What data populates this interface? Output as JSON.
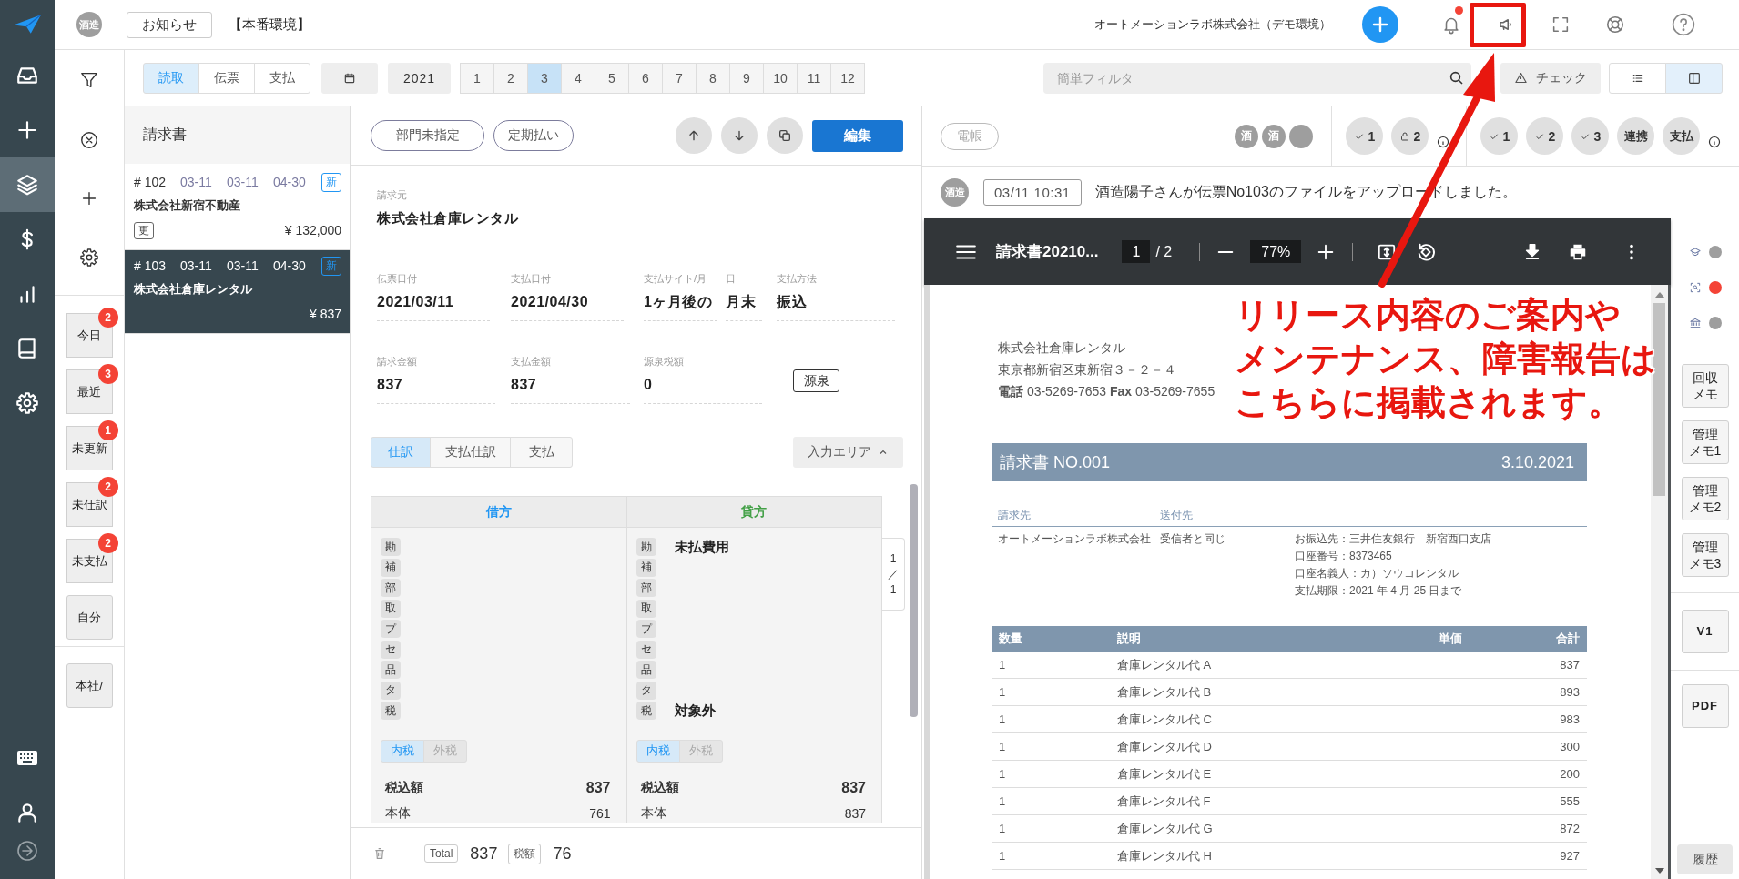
{
  "nav": {
    "items": [
      {
        "selected": false
      },
      {
        "selected": false
      },
      {
        "selected": true
      },
      {
        "selected": false
      },
      {
        "selected": false
      },
      {
        "selected": false
      },
      {
        "selected": false
      }
    ]
  },
  "top_bar": {
    "avatar": "酒造",
    "notice_button": "お知らせ",
    "environment": "【本番環境】",
    "company": "オートメーションラボ株式会社（デモ環境）",
    "has_unread": true
  },
  "filter_panel": {
    "quick_filters": [
      {
        "label": "今日",
        "count": "2"
      },
      {
        "label": "最近",
        "count": "3"
      },
      {
        "label": "未更新",
        "count": "1"
      },
      {
        "label": "未仕訳",
        "count": "2"
      },
      {
        "label": "未支払",
        "count": "2"
      },
      {
        "label": "自分"
      }
    ],
    "branch_filters": [
      {
        "label": "本社/"
      }
    ]
  },
  "toolbar": {
    "modes": [
      {
        "label": "読取",
        "selected": true
      },
      {
        "label": "伝票",
        "selected": false
      },
      {
        "label": "支払",
        "selected": false
      }
    ],
    "year": "2021",
    "months": [
      {
        "label": "1",
        "selected": false
      },
      {
        "label": "2",
        "selected": false
      },
      {
        "label": "3",
        "selected": true
      },
      {
        "label": "4",
        "selected": false
      },
      {
        "label": "5",
        "selected": false
      },
      {
        "label": "6",
        "selected": false
      },
      {
        "label": "7",
        "selected": false
      },
      {
        "label": "8",
        "selected": false
      },
      {
        "label": "9",
        "selected": false
      },
      {
        "label": "10",
        "selected": false
      },
      {
        "label": "11",
        "selected": false
      },
      {
        "label": "12",
        "selected": false
      }
    ],
    "search": {
      "placeholder": "簡単フィルタ"
    },
    "check_button": "チェック",
    "views": [
      {
        "selected": false
      },
      {
        "selected": true
      }
    ]
  },
  "invoice_list": {
    "title": "請求書",
    "items": [
      {
        "number": "# 102",
        "dates": [
          "03-11",
          "03-11",
          "04-30"
        ],
        "badge": "新",
        "company": "株式会社新宿不動産",
        "tag": "更",
        "amount": "¥ 132,000",
        "selected": false
      },
      {
        "number": "# 103",
        "dates": [
          "03-11",
          "03-11",
          "04-30"
        ],
        "badge": "新",
        "company": "株式会社倉庫レンタル",
        "amount": "¥ 837",
        "selected": true
      }
    ]
  },
  "detail": {
    "chips": [
      "部門未指定",
      "定期払い"
    ],
    "edit_button": "編集",
    "field_rows": [
      [
        {
          "label": "請求元",
          "value": "株式会社倉庫レンタル"
        }
      ],
      [
        {
          "label": "伝票日付",
          "value": "2021/03/11"
        },
        {
          "label": "支払日付",
          "value": "2021/04/30"
        },
        {
          "label": "支払サイト/月",
          "value": "1ヶ月後の"
        },
        {
          "label": "日",
          "value": "月末"
        },
        {
          "label": "支払方法",
          "value": "振込"
        }
      ],
      [
        {
          "label": "請求金額",
          "value": "837"
        },
        {
          "label": "支払金額",
          "value": "837"
        },
        {
          "label": "源泉税額",
          "value": "0"
        }
      ]
    ],
    "withholding_button": "源泉",
    "tabs": [
      {
        "label": "仕訳",
        "selected": true
      },
      {
        "label": "支払仕訳",
        "selected": false
      },
      {
        "label": "支払",
        "selected": false
      }
    ],
    "input_area_button": "入力エリア",
    "journal": {
      "columns": [
        {
          "title": "借方",
          "color": "#2196f3",
          "rows": [
            {
              "tag": "勘"
            },
            {
              "tag": "補"
            },
            {
              "tag": "部"
            },
            {
              "tag": "取"
            },
            {
              "tag": "プ"
            },
            {
              "tag": "セ"
            },
            {
              "tag": "品"
            },
            {
              "tag": "タ"
            },
            {
              "tag": "税"
            }
          ],
          "tax_modes": [
            {
              "label": "内税",
              "selected": true
            },
            {
              "label": "外税",
              "selected": false
            }
          ],
          "totals": [
            {
              "label": "税込額",
              "value": "837"
            },
            {
              "label": "本体",
              "value": "761"
            }
          ]
        },
        {
          "title": "貸方",
          "color": "#43a047",
          "rows": [
            {
              "tag": "勘",
              "value": "未払費用"
            },
            {
              "tag": "補"
            },
            {
              "tag": "部"
            },
            {
              "tag": "取"
            },
            {
              "tag": "プ"
            },
            {
              "tag": "セ"
            },
            {
              "tag": "品"
            },
            {
              "tag": "タ"
            },
            {
              "tag": "税",
              "value": "対象外"
            }
          ],
          "tax_modes": [
            {
              "label": "内税",
              "selected": true
            },
            {
              "label": "外税",
              "selected": false
            }
          ],
          "totals": [
            {
              "label": "税込額",
              "value": "837"
            },
            {
              "label": "本体",
              "value": "837"
            }
          ]
        }
      ],
      "page_indicator": {
        "current": "1",
        "separator": "／",
        "total": "1"
      }
    },
    "footer": {
      "total_label": "Total",
      "total": "837",
      "tax_label": "税額",
      "tax": "76"
    }
  },
  "review_panel": {
    "archive_chip": {
      "label": "電帳",
      "disabled": true
    },
    "avatars": [
      {
        "kind": "initial",
        "label": "酒"
      },
      {
        "kind": "initial",
        "label": "酒"
      },
      {
        "kind": "blank"
      }
    ],
    "approval_groups": [
      [
        {
          "kind": "check",
          "label": "1"
        },
        {
          "kind": "lock",
          "label": "2"
        }
      ],
      [
        {
          "kind": "check",
          "label": "1"
        },
        {
          "kind": "check",
          "label": "2"
        },
        {
          "kind": "check",
          "label": "3"
        },
        {
          "kind": "text",
          "label": "連携"
        },
        {
          "kind": "text",
          "label": "支払"
        }
      ]
    ],
    "activity": {
      "avatar": "酒造",
      "time": "03/11 10:31",
      "message": "酒造陽子さんが伝票No103のファイルをアップロードしました。"
    }
  },
  "pdf_viewer": {
    "title": "請求書20210...",
    "page": "1",
    "page_of": "/ 2",
    "zoom": "77%",
    "document": {
      "sender": {
        "name": "株式会社倉庫レンタル",
        "address": "東京都新宿区東新宿３－２－４",
        "contact": "**電話** 03-5269-7653 **Fax** 03-5269-7655"
      },
      "title": "請求書 NO.001",
      "date": "3.10.2021",
      "bill_to_label": "請求先",
      "ship_to_label": "送付先",
      "bill_to": "オートメーションラボ株式会社",
      "ship_to": "受信者と同じ",
      "payment_info": [
        "お振込先：三井住友銀行　新宿西口支店",
        "口座番号：8373465",
        "口座名義人：カ）ソウコレンタル",
        "支払期限：2021 年 4 月 25 日まで"
      ],
      "table": {
        "columns": [
          "数量",
          "説明",
          "単価",
          "合計"
        ],
        "rows": [
          {
            "quantity": "1",
            "description": "倉庫レンタル代 A",
            "total": "837"
          },
          {
            "quantity": "1",
            "description": "倉庫レンタル代 B",
            "total": "893"
          },
          {
            "quantity": "1",
            "description": "倉庫レンタル代 C",
            "total": "983"
          },
          {
            "quantity": "1",
            "description": "倉庫レンタル代 D",
            "total": "300"
          },
          {
            "quantity": "1",
            "description": "倉庫レンタル代 E",
            "total": "200"
          },
          {
            "quantity": "1",
            "description": "倉庫レンタル代 F",
            "total": "555"
          },
          {
            "quantity": "1",
            "description": "倉庫レンタル代 G",
            "total": "872"
          },
          {
            "quantity": "1",
            "description": "倉庫レンタル代 H",
            "total": "927"
          }
        ]
      }
    }
  },
  "side_strip": {
    "status_icons": [
      {
        "color": "#9e9e9e"
      },
      {
        "color": "#f44336"
      },
      {
        "color": "#9e9e9e"
      }
    ],
    "memo_buttons": [
      "回収メモ",
      "管理メモ1",
      "管理メモ2",
      "管理メモ3"
    ],
    "version_button": "V1",
    "pdf_button": "PDF",
    "history_button": "履歴"
  },
  "annotation": {
    "lines": [
      "リリース内容のご案内や",
      "メンテナンス、障害報告は",
      "こちらに掲載されます。"
    ]
  }
}
